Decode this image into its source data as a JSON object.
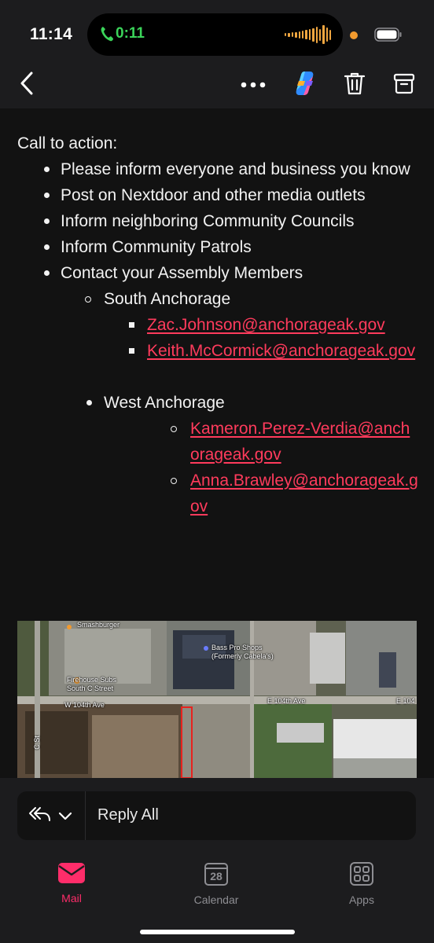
{
  "status_bar": {
    "time": "11:14",
    "call_timer": "0:11"
  },
  "toolbar": {
    "back_icon": "chevron-left-icon",
    "more_icon": "ellipsis-icon",
    "copilot_icon": "copilot-icon",
    "delete_icon": "trash-icon",
    "archive_icon": "archive-icon"
  },
  "email": {
    "heading": "Call to action:",
    "bullets": [
      "Please inform everyone and business you know",
      "Post on Nextdoor and other media outlets",
      "Inform neighboring Community Councils",
      "Inform Community Patrols",
      "Contact your Assembly Members"
    ],
    "south": {
      "label": "South Anchorage",
      "emails": [
        "Zac.Johnson@anchorageak.gov",
        "Keith.McCormick@anchorageak.gov"
      ]
    },
    "west": {
      "label": "West Anchorage",
      "emails": [
        "Kameron.Perez-Verdia@anchorageak.gov",
        "Anna.Brawley@anchorageak.gov"
      ]
    }
  },
  "map": {
    "labels": {
      "smashburger": "Smashburger",
      "bass_pro": "Bass Pro Shops",
      "bass_pro_sub": "(Formerly Cabela's)",
      "firehouse": "Firehouse Subs",
      "firehouse_sub": "South C Street",
      "w104": "W 104th Ave",
      "e104": "E 104th Ave",
      "e104_right": "E 104",
      "c_st": "C St"
    }
  },
  "reply": {
    "label": "Reply All"
  },
  "tabs": {
    "mail": "Mail",
    "calendar": "Calendar",
    "calendar_day": "28",
    "apps": "Apps"
  },
  "colors": {
    "accent": "#ff3b5c",
    "call_green": "#3bd45a",
    "background": "#121212"
  }
}
